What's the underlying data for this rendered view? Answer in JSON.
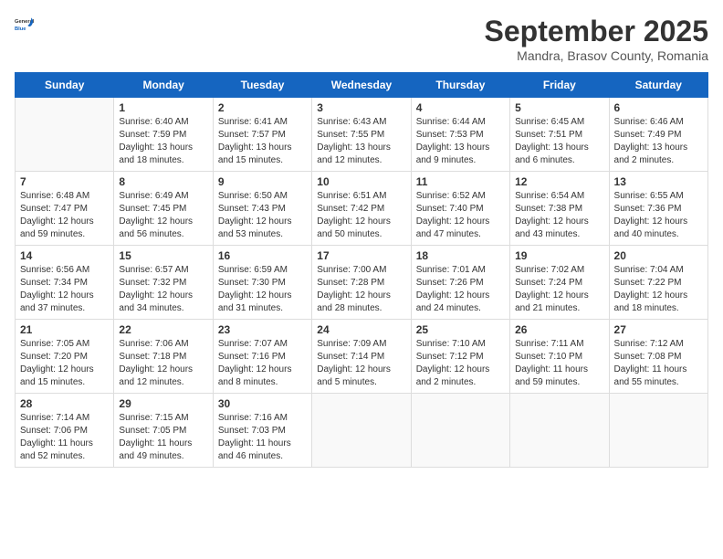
{
  "header": {
    "logo_general": "General",
    "logo_blue": "Blue",
    "month": "September 2025",
    "location": "Mandra, Brasov County, Romania"
  },
  "weekdays": [
    "Sunday",
    "Monday",
    "Tuesday",
    "Wednesday",
    "Thursday",
    "Friday",
    "Saturday"
  ],
  "weeks": [
    [
      {
        "day": "",
        "info": ""
      },
      {
        "day": "1",
        "info": "Sunrise: 6:40 AM\nSunset: 7:59 PM\nDaylight: 13 hours\nand 18 minutes."
      },
      {
        "day": "2",
        "info": "Sunrise: 6:41 AM\nSunset: 7:57 PM\nDaylight: 13 hours\nand 15 minutes."
      },
      {
        "day": "3",
        "info": "Sunrise: 6:43 AM\nSunset: 7:55 PM\nDaylight: 13 hours\nand 12 minutes."
      },
      {
        "day": "4",
        "info": "Sunrise: 6:44 AM\nSunset: 7:53 PM\nDaylight: 13 hours\nand 9 minutes."
      },
      {
        "day": "5",
        "info": "Sunrise: 6:45 AM\nSunset: 7:51 PM\nDaylight: 13 hours\nand 6 minutes."
      },
      {
        "day": "6",
        "info": "Sunrise: 6:46 AM\nSunset: 7:49 PM\nDaylight: 13 hours\nand 2 minutes."
      }
    ],
    [
      {
        "day": "7",
        "info": "Sunrise: 6:48 AM\nSunset: 7:47 PM\nDaylight: 12 hours\nand 59 minutes."
      },
      {
        "day": "8",
        "info": "Sunrise: 6:49 AM\nSunset: 7:45 PM\nDaylight: 12 hours\nand 56 minutes."
      },
      {
        "day": "9",
        "info": "Sunrise: 6:50 AM\nSunset: 7:43 PM\nDaylight: 12 hours\nand 53 minutes."
      },
      {
        "day": "10",
        "info": "Sunrise: 6:51 AM\nSunset: 7:42 PM\nDaylight: 12 hours\nand 50 minutes."
      },
      {
        "day": "11",
        "info": "Sunrise: 6:52 AM\nSunset: 7:40 PM\nDaylight: 12 hours\nand 47 minutes."
      },
      {
        "day": "12",
        "info": "Sunrise: 6:54 AM\nSunset: 7:38 PM\nDaylight: 12 hours\nand 43 minutes."
      },
      {
        "day": "13",
        "info": "Sunrise: 6:55 AM\nSunset: 7:36 PM\nDaylight: 12 hours\nand 40 minutes."
      }
    ],
    [
      {
        "day": "14",
        "info": "Sunrise: 6:56 AM\nSunset: 7:34 PM\nDaylight: 12 hours\nand 37 minutes."
      },
      {
        "day": "15",
        "info": "Sunrise: 6:57 AM\nSunset: 7:32 PM\nDaylight: 12 hours\nand 34 minutes."
      },
      {
        "day": "16",
        "info": "Sunrise: 6:59 AM\nSunset: 7:30 PM\nDaylight: 12 hours\nand 31 minutes."
      },
      {
        "day": "17",
        "info": "Sunrise: 7:00 AM\nSunset: 7:28 PM\nDaylight: 12 hours\nand 28 minutes."
      },
      {
        "day": "18",
        "info": "Sunrise: 7:01 AM\nSunset: 7:26 PM\nDaylight: 12 hours\nand 24 minutes."
      },
      {
        "day": "19",
        "info": "Sunrise: 7:02 AM\nSunset: 7:24 PM\nDaylight: 12 hours\nand 21 minutes."
      },
      {
        "day": "20",
        "info": "Sunrise: 7:04 AM\nSunset: 7:22 PM\nDaylight: 12 hours\nand 18 minutes."
      }
    ],
    [
      {
        "day": "21",
        "info": "Sunrise: 7:05 AM\nSunset: 7:20 PM\nDaylight: 12 hours\nand 15 minutes."
      },
      {
        "day": "22",
        "info": "Sunrise: 7:06 AM\nSunset: 7:18 PM\nDaylight: 12 hours\nand 12 minutes."
      },
      {
        "day": "23",
        "info": "Sunrise: 7:07 AM\nSunset: 7:16 PM\nDaylight: 12 hours\nand 8 minutes."
      },
      {
        "day": "24",
        "info": "Sunrise: 7:09 AM\nSunset: 7:14 PM\nDaylight: 12 hours\nand 5 minutes."
      },
      {
        "day": "25",
        "info": "Sunrise: 7:10 AM\nSunset: 7:12 PM\nDaylight: 12 hours\nand 2 minutes."
      },
      {
        "day": "26",
        "info": "Sunrise: 7:11 AM\nSunset: 7:10 PM\nDaylight: 11 hours\nand 59 minutes."
      },
      {
        "day": "27",
        "info": "Sunrise: 7:12 AM\nSunset: 7:08 PM\nDaylight: 11 hours\nand 55 minutes."
      }
    ],
    [
      {
        "day": "28",
        "info": "Sunrise: 7:14 AM\nSunset: 7:06 PM\nDaylight: 11 hours\nand 52 minutes."
      },
      {
        "day": "29",
        "info": "Sunrise: 7:15 AM\nSunset: 7:05 PM\nDaylight: 11 hours\nand 49 minutes."
      },
      {
        "day": "30",
        "info": "Sunrise: 7:16 AM\nSunset: 7:03 PM\nDaylight: 11 hours\nand 46 minutes."
      },
      {
        "day": "",
        "info": ""
      },
      {
        "day": "",
        "info": ""
      },
      {
        "day": "",
        "info": ""
      },
      {
        "day": "",
        "info": ""
      }
    ]
  ]
}
